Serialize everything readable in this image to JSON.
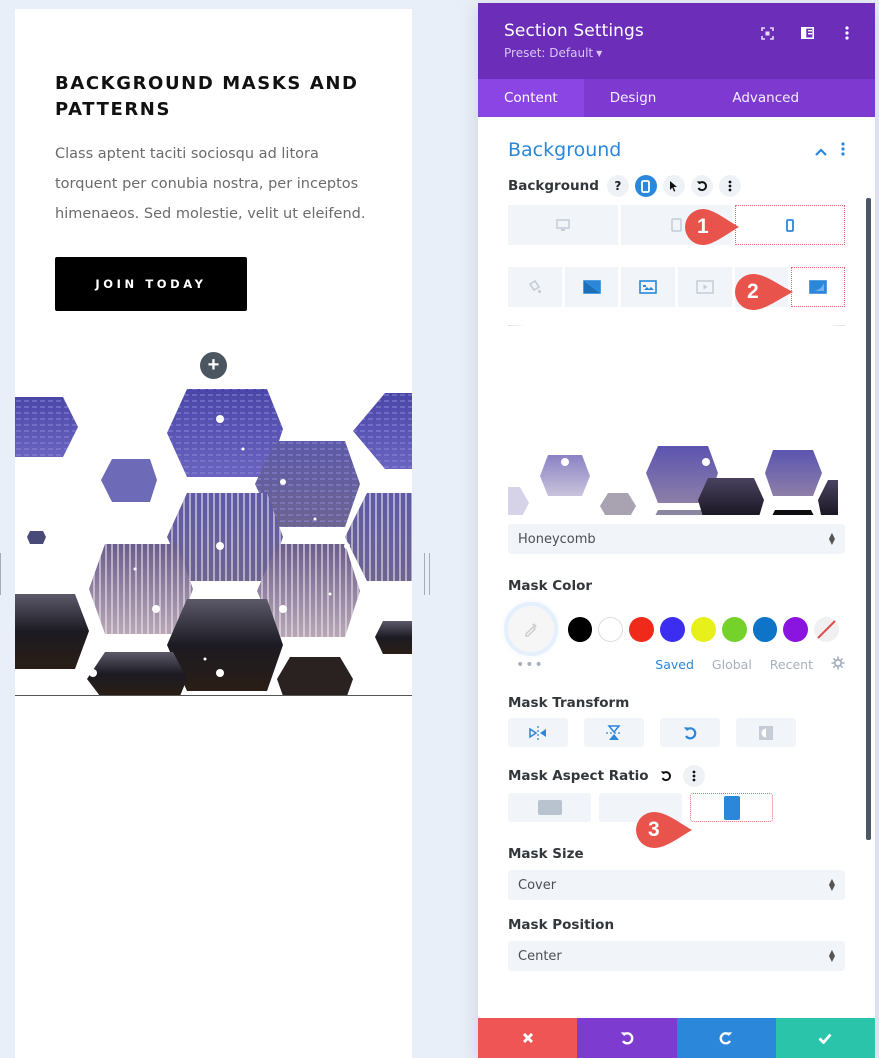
{
  "preview": {
    "title": "BACKGROUND MASKS AND PATTERNS",
    "body": "Class aptent taciti sociosqu ad litora torquent per conubia nostra, per inceptos himenaeos. Sed molestie, velit ut eleifend.",
    "cta_label": "JOIN TODAY",
    "add_icon": "plus-icon"
  },
  "panel": {
    "title": "Section Settings",
    "preset": "Preset: Default",
    "header_icons": [
      "expand-icon",
      "split-view-icon",
      "more-vertical-icon"
    ],
    "tabs": [
      {
        "label": "Content",
        "active": true
      },
      {
        "label": "Design",
        "active": false
      },
      {
        "label": "Advanced",
        "active": false
      }
    ],
    "section_title": "Background",
    "background_label": "Background",
    "background_label_icons": [
      "help-icon",
      "phone-icon",
      "pointer-icon",
      "reset-icon",
      "more-vertical-icon"
    ],
    "device_buttons": [
      {
        "icon": "desktop-icon",
        "selected": false
      },
      {
        "icon": "tablet-icon",
        "selected": false
      },
      {
        "icon": "phone-icon",
        "selected": true
      }
    ],
    "bg_type_buttons": [
      {
        "icon": "paint-bucket-icon",
        "selected": false
      },
      {
        "icon": "gradient-icon",
        "selected": false
      },
      {
        "icon": "image-icon",
        "selected": false
      },
      {
        "icon": "video-icon",
        "selected": false
      },
      {
        "icon": "pattern-icon",
        "selected": false
      },
      {
        "icon": "mask-icon",
        "selected": true
      }
    ],
    "mask_style": "Honeycomb",
    "mask_color_label": "Mask Color",
    "swatches": [
      "#000000",
      "#ffffff",
      "#f02a1b",
      "#3b2ef0",
      "#e7f01a",
      "#74d22a",
      "#0d74c8",
      "#8a14e0"
    ],
    "palette_tabs": [
      {
        "label": "Saved",
        "active": true
      },
      {
        "label": "Global",
        "active": false
      },
      {
        "label": "Recent",
        "active": false
      }
    ],
    "mask_transform_label": "Mask Transform",
    "transform_buttons": [
      "flip-horizontal-icon",
      "flip-vertical-icon",
      "rotate-icon",
      "invert-icon"
    ],
    "mask_aspect_ratio_label": "Mask Aspect Ratio",
    "aspect_ratio_buttons": [
      {
        "icon": "landscape-icon",
        "selected": false
      },
      {
        "icon": "square-icon",
        "selected": false
      },
      {
        "icon": "portrait-icon",
        "selected": true
      }
    ],
    "mask_size_label": "Mask Size",
    "mask_size": "Cover",
    "mask_position_label": "Mask Position",
    "mask_position": "Center",
    "footer": [
      {
        "icon": "close-icon",
        "color": "#ef5555"
      },
      {
        "icon": "undo-icon",
        "color": "#7e3bd0"
      },
      {
        "icon": "redo-icon",
        "color": "#2b87da"
      },
      {
        "icon": "check-icon",
        "color": "#29c4a9"
      }
    ]
  },
  "callouts": [
    "1",
    "2",
    "3"
  ],
  "colors": {
    "header": "#6c2eb9",
    "tabs": "#7d39d0",
    "accent": "#2b87da",
    "callout": "#e8534b"
  }
}
